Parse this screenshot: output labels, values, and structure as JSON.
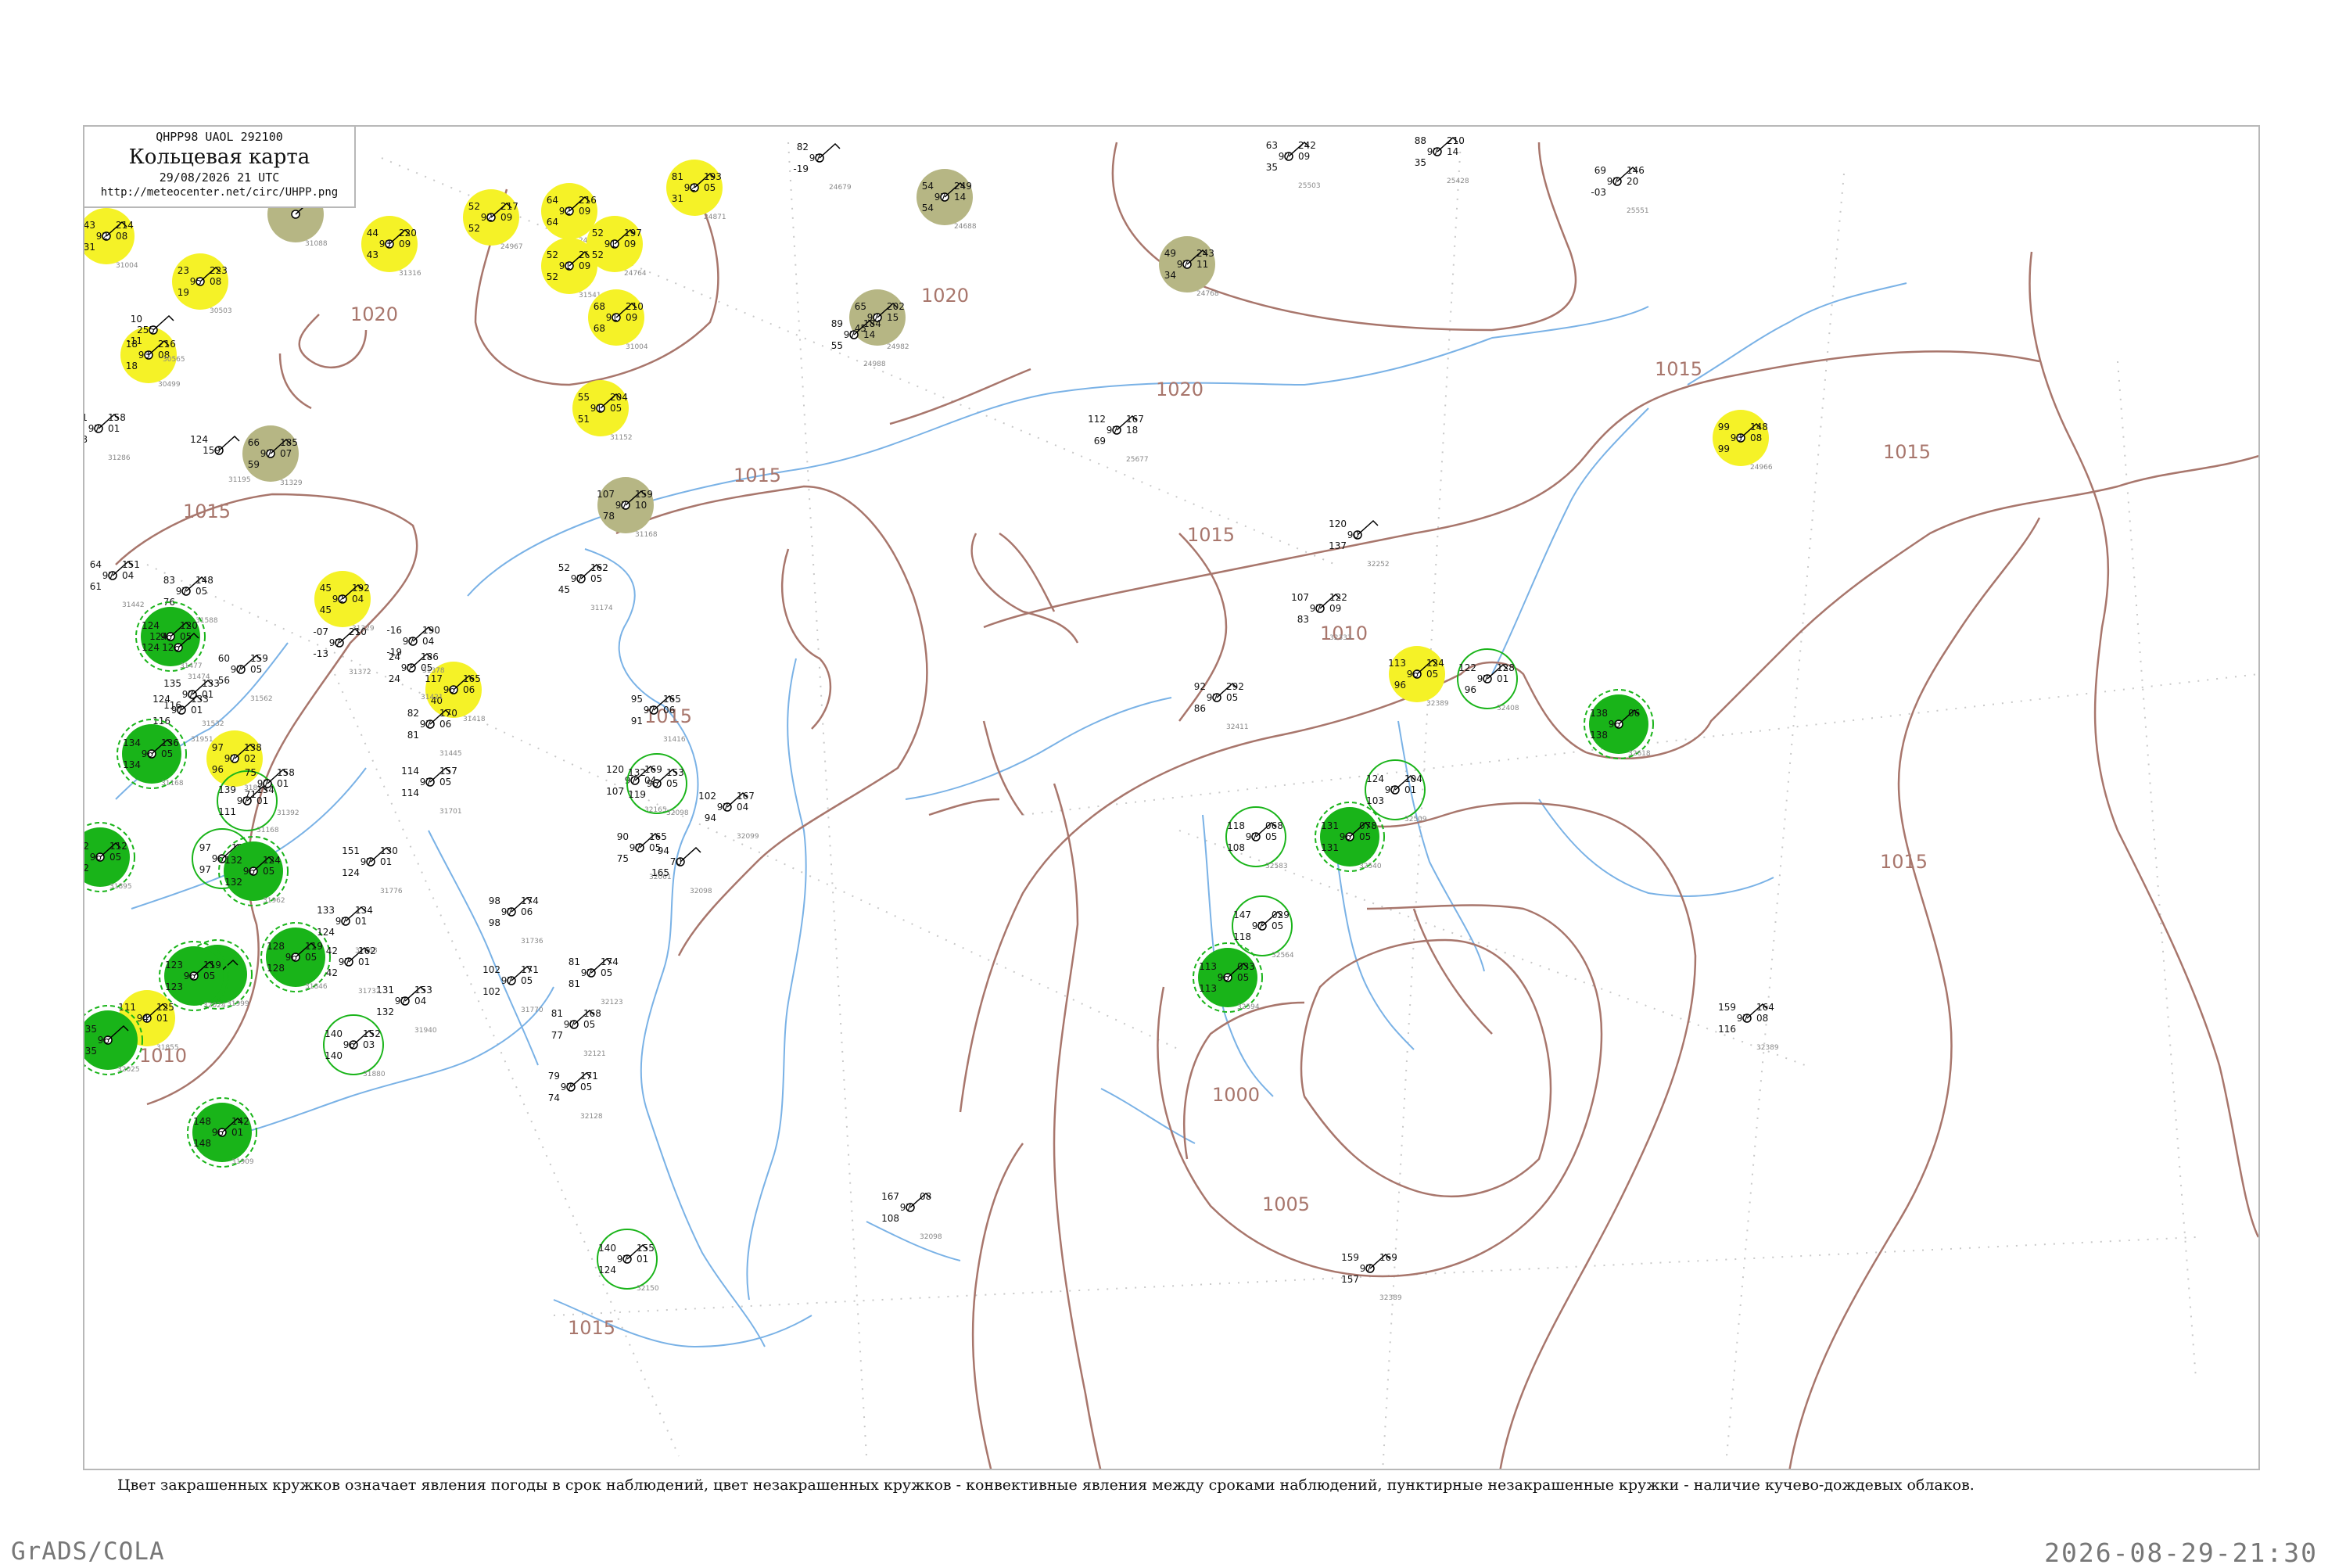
{
  "header": {
    "code_line": "QHPP98  UAOL  292100",
    "title": "Кольцевая карта",
    "datetime": "29/08/2026 21 UTC",
    "url": "http://meteocenter.net/circ/UHPP.png"
  },
  "colors": {
    "isobar": "#a8766c",
    "river": "#7ab2e6",
    "frame": "#b8b8b8",
    "rain_green": "#19b419",
    "yellow": "#f5f227",
    "fog_olive": "#b6b684"
  },
  "isobar_labels": [
    "1020",
    "1020",
    "1020",
    "1015",
    "1015",
    "1015",
    "1015",
    "1015",
    "1015",
    "1010",
    "1010",
    "1005",
    "1000",
    "1015",
    "1015"
  ],
  "stations": [
    {
      "n": "31004",
      "fill": "yellow",
      "v": [
        "43",
        "92",
        "31",
        "214",
        "08"
      ]
    },
    {
      "n": "31088",
      "fill": "olive",
      "v": []
    },
    {
      "n": "24967",
      "fill": "yellow",
      "v": [
        "52",
        "92",
        "52",
        "217",
        "09"
      ]
    },
    {
      "n": "24962",
      "fill": "yellow",
      "v": [
        "64",
        "92",
        "64",
        "216",
        "09"
      ]
    },
    {
      "n": "24871",
      "fill": "yellow",
      "v": [
        "81",
        "92",
        "31",
        "193",
        "05"
      ]
    },
    {
      "n": "24679",
      "fill": "none",
      "v": [
        "82",
        "97",
        "-19"
      ]
    },
    {
      "n": "24688",
      "fill": "olive",
      "v": [
        "54",
        "97",
        "54",
        "249",
        "14"
      ]
    },
    {
      "n": "25503",
      "fill": "none",
      "v": [
        "63",
        "97",
        "35",
        "242",
        "09"
      ]
    },
    {
      "n": "25428",
      "fill": "none",
      "v": [
        "88",
        "97",
        "35",
        "210",
        "14"
      ]
    },
    {
      "n": "25551",
      "fill": "none",
      "v": [
        "69",
        "97",
        "-03",
        "146",
        "20"
      ]
    },
    {
      "n": "31316",
      "fill": "yellow",
      "v": [
        "44",
        "93",
        "43",
        "220",
        "09"
      ]
    },
    {
      "n": "31541",
      "fill": "yellow",
      "v": [
        "52",
        "91",
        "52",
        "207",
        "09"
      ]
    },
    {
      "n": "24764",
      "fill": "yellow",
      "v": [
        "52",
        "91",
        "52",
        "197",
        "09"
      ]
    },
    {
      "n": "24768",
      "fill": "olive",
      "v": [
        "49",
        "97",
        "34",
        "243",
        "11"
      ]
    },
    {
      "n": "30503",
      "fill": "yellow",
      "v": [
        "23",
        "95",
        "19",
        "223",
        "08"
      ]
    },
    {
      "n": "30499",
      "fill": "yellow",
      "v": [
        "18",
        "93",
        "18",
        "216",
        "08"
      ]
    },
    {
      "n": "31004b",
      "fill": "yellow",
      "v": [
        "68",
        "91",
        "68",
        "210",
        "09"
      ]
    },
    {
      "n": "24982",
      "fill": "olive",
      "v": [
        "65",
        "97",
        "45",
        "202",
        "15"
      ]
    },
    {
      "n": "24988",
      "fill": "none",
      "v": [
        "89",
        "97",
        "55",
        "184",
        "14"
      ]
    },
    {
      "n": "31152",
      "fill": "yellow",
      "v": [
        "55",
        "91",
        "51",
        "204",
        "05"
      ]
    },
    {
      "n": "31329",
      "fill": "olive",
      "v": [
        "66",
        "97",
        "59",
        "185",
        "07"
      ]
    },
    {
      "n": "31168",
      "fill": "olive",
      "v": [
        "107",
        "97",
        "78",
        "159",
        "10"
      ]
    },
    {
      "n": "24966",
      "fill": "yellow",
      "v": [
        "99",
        "93",
        "99",
        "148",
        "08"
      ]
    },
    {
      "n": "25677",
      "fill": "none",
      "v": [
        "112",
        "97",
        "69",
        "167",
        "18"
      ]
    },
    {
      "n": "31174",
      "fill": "none",
      "v": [
        "52",
        "97",
        "45",
        "162",
        "05"
      ]
    },
    {
      "n": "31329b",
      "fill": "yellow",
      "v": [
        "45",
        "92",
        "45",
        "192",
        "04"
      ]
    },
    {
      "n": "32252",
      "fill": "none",
      "v": [
        "120",
        "90",
        "137"
      ]
    },
    {
      "n": "32333",
      "fill": "none",
      "v": [
        "107",
        "97",
        "83",
        "122",
        "09"
      ]
    },
    {
      "n": "32389",
      "fill": "yellow",
      "v": [
        "113",
        "96",
        "96",
        "124",
        "05"
      ]
    },
    {
      "n": "32408",
      "fill": "ring",
      "v": [
        "122",
        "97",
        "96",
        "128",
        "01"
      ]
    },
    {
      "n": "32411",
      "fill": "none",
      "v": [
        "92",
        "97",
        "86",
        "292",
        "05"
      ]
    },
    {
      "n": "32618",
      "fill": "green",
      "v": [
        "138",
        "96",
        "138",
        "06"
      ]
    },
    {
      "n": "32509",
      "fill": "ring",
      "v": [
        "124",
        "97",
        "103",
        "104",
        "01"
      ]
    },
    {
      "n": "32583",
      "fill": "ring",
      "v": [
        "118",
        "97",
        "108",
        "068",
        "05"
      ]
    },
    {
      "n": "32540",
      "fill": "green",
      "v": [
        "131",
        "96",
        "131",
        "078",
        "05"
      ]
    },
    {
      "n": "32564",
      "fill": "ring",
      "v": [
        "147",
        "97",
        "118",
        "029",
        "05"
      ]
    },
    {
      "n": "32594",
      "fill": "green",
      "v": [
        "113",
        "96",
        "113",
        "033",
        "05"
      ]
    },
    {
      "n": "31418",
      "fill": "yellow",
      "v": [
        "117",
        "96",
        "40",
        "165",
        "06"
      ]
    },
    {
      "n": "32061",
      "fill": "none",
      "v": [
        "90",
        "97",
        "75",
        "165",
        "05"
      ]
    },
    {
      "n": "31416",
      "fill": "none",
      "v": [
        "95",
        "97",
        "91",
        "165",
        "06"
      ]
    },
    {
      "n": "32165",
      "fill": "none",
      "v": [
        "120",
        "97",
        "107",
        "169",
        "04"
      ]
    },
    {
      "n": "32098",
      "fill": "ring",
      "v": [
        "132",
        "96",
        "119",
        "153",
        "05"
      ]
    },
    {
      "n": "32099",
      "fill": "none",
      "v": [
        "102",
        "97",
        "94",
        "167",
        "04"
      ]
    },
    {
      "n": "31951",
      "fill": "none",
      "v": [
        "124",
        "97",
        "116",
        "133",
        "01"
      ]
    },
    {
      "n": "31855",
      "fill": "yellow",
      "v": [
        "97",
        "97",
        "96",
        "138",
        "02"
      ]
    },
    {
      "n": "31168b",
      "fill": "green",
      "v": [
        "134",
        "96",
        "134",
        "136",
        "05"
      ]
    },
    {
      "n": "31168c",
      "fill": "ring",
      "v": [
        "139",
        "97",
        "111",
        "134",
        "01"
      ]
    },
    {
      "n": "31873",
      "fill": "ring",
      "v": [
        "97",
        "96",
        "97",
        "137",
        "03"
      ]
    },
    {
      "n": "31962",
      "fill": "green",
      "v": [
        "132",
        "96",
        "132",
        "124",
        "05"
      ]
    },
    {
      "n": "31895",
      "fill": "green",
      "v": [
        "112",
        "96",
        "112",
        "112",
        "05"
      ]
    },
    {
      "n": "31999",
      "fill": "green",
      "v": [
        "104",
        "96",
        "104"
      ]
    },
    {
      "n": "31846",
      "fill": "green",
      "v": [
        "128",
        "96",
        "128",
        "119",
        "05"
      ]
    },
    {
      "n": "31855b",
      "fill": "yellow",
      "v": [
        "111",
        "94",
        "111",
        "125",
        "01"
      ]
    },
    {
      "n": "32024",
      "fill": "green",
      "v": [
        "123",
        "96",
        "123",
        "119",
        "05"
      ]
    },
    {
      "n": "32025",
      "fill": "green",
      "v": [
        "135",
        "96",
        "135"
      ]
    },
    {
      "n": "31909",
      "fill": "green",
      "v": [
        "148",
        "96",
        "148",
        "142",
        "01"
      ]
    },
    {
      "n": "31880",
      "fill": "ring",
      "v": [
        "140",
        "96",
        "140",
        "152",
        "03"
      ]
    },
    {
      "n": "31940",
      "fill": "none",
      "v": [
        "131",
        "97",
        "132",
        "153",
        "04"
      ]
    },
    {
      "n": "32123",
      "fill": "none",
      "v": [
        "81",
        "97",
        "81",
        "174",
        "05"
      ]
    },
    {
      "n": "32121",
      "fill": "none",
      "v": [
        "81",
        "97",
        "77",
        "168",
        "05"
      ]
    },
    {
      "n": "32128",
      "fill": "none",
      "v": [
        "79",
        "97",
        "74",
        "171",
        "05"
      ]
    },
    {
      "n": "32150",
      "fill": "ring",
      "v": [
        "140",
        "97",
        "124",
        "155",
        "01"
      ]
    },
    {
      "n": "31770",
      "fill": "none",
      "v": [
        "102",
        "97",
        "102",
        "171",
        "05"
      ]
    },
    {
      "n": "31736",
      "fill": "none",
      "v": [
        "98",
        "97",
        "98",
        "174",
        "06"
      ]
    },
    {
      "n": "31701",
      "fill": "none",
      "v": [
        "114",
        "97",
        "114",
        "157",
        "05"
      ]
    },
    {
      "n": "31445",
      "fill": "none",
      "v": [
        "82",
        "97",
        "81",
        "170",
        "06"
      ]
    },
    {
      "n": "31421",
      "fill": "none",
      "v": [
        "24",
        "97",
        "24",
        "186",
        "05"
      ]
    },
    {
      "n": "31372",
      "fill": "none",
      "v": [
        "-07",
        "97",
        "-13",
        "210"
      ]
    },
    {
      "n": "31378",
      "fill": "none",
      "v": [
        "-16",
        "97",
        "-19",
        "190",
        "04"
      ]
    },
    {
      "n": "31392",
      "fill": "none",
      "v": [
        "75",
        "97",
        "71",
        "158",
        "01"
      ]
    },
    {
      "n": "31776",
      "fill": "none",
      "v": [
        "151",
        "97",
        "124",
        "130",
        "01"
      ]
    },
    {
      "n": "31868",
      "fill": "none",
      "v": [
        "133",
        "97",
        "124",
        "134",
        "01"
      ]
    },
    {
      "n": "31732",
      "fill": "none",
      "v": [
        "42",
        "97",
        "42",
        "162",
        "01"
      ]
    },
    {
      "n": "31442",
      "fill": "none",
      "v": [
        "64",
        "97",
        "61",
        "151",
        "04"
      ]
    },
    {
      "n": "31588",
      "fill": "none",
      "v": [
        "83",
        "97",
        "76",
        "148",
        "05"
      ]
    },
    {
      "n": "31286",
      "fill": "none",
      "v": [
        "71",
        "97",
        "88",
        "158",
        "01"
      ]
    },
    {
      "n": "31195",
      "fill": "none",
      "v": [
        "124",
        "159"
      ]
    },
    {
      "n": "31562",
      "fill": "none",
      "v": [
        "60",
        "97",
        "56",
        "159",
        "05"
      ]
    },
    {
      "n": "31532",
      "fill": "none",
      "v": [
        "135",
        "97",
        "116",
        "133",
        "01"
      ]
    },
    {
      "n": "31477",
      "fill": "green",
      "v": [
        "124",
        "96",
        "124",
        "120",
        "05"
      ]
    },
    {
      "n": "31474",
      "fill": "none",
      "v": [
        "124",
        "126"
      ]
    },
    {
      "n": "30565",
      "fill": "none",
      "v": [
        "10",
        "255",
        "-11"
      ]
    },
    {
      "n": "32098b",
      "fill": "none",
      "v": [
        "94",
        "70",
        "165"
      ]
    },
    {
      "n": "32389b",
      "fill": "none",
      "v": [
        "159",
        "97",
        "116",
        "164",
        "08"
      ]
    },
    {
      "n": "32389c",
      "fill": "none",
      "v": [
        "159",
        "97",
        "157",
        "169"
      ]
    },
    {
      "n": "32098c",
      "fill": "none",
      "v": [
        "167",
        "97",
        "108",
        "08"
      ]
    }
  ],
  "footnote": "Цвет закрашенных кружков означает явления погоды в срок наблюдений, цвет незакрашенных кружков - конвективные явления между сроками наблюдений, пунктирные незакрашенные кружки - наличие кучево-дождевых облаков.",
  "footer": {
    "left": "GrADS/COLA",
    "right": "2026-08-29-21:30"
  }
}
